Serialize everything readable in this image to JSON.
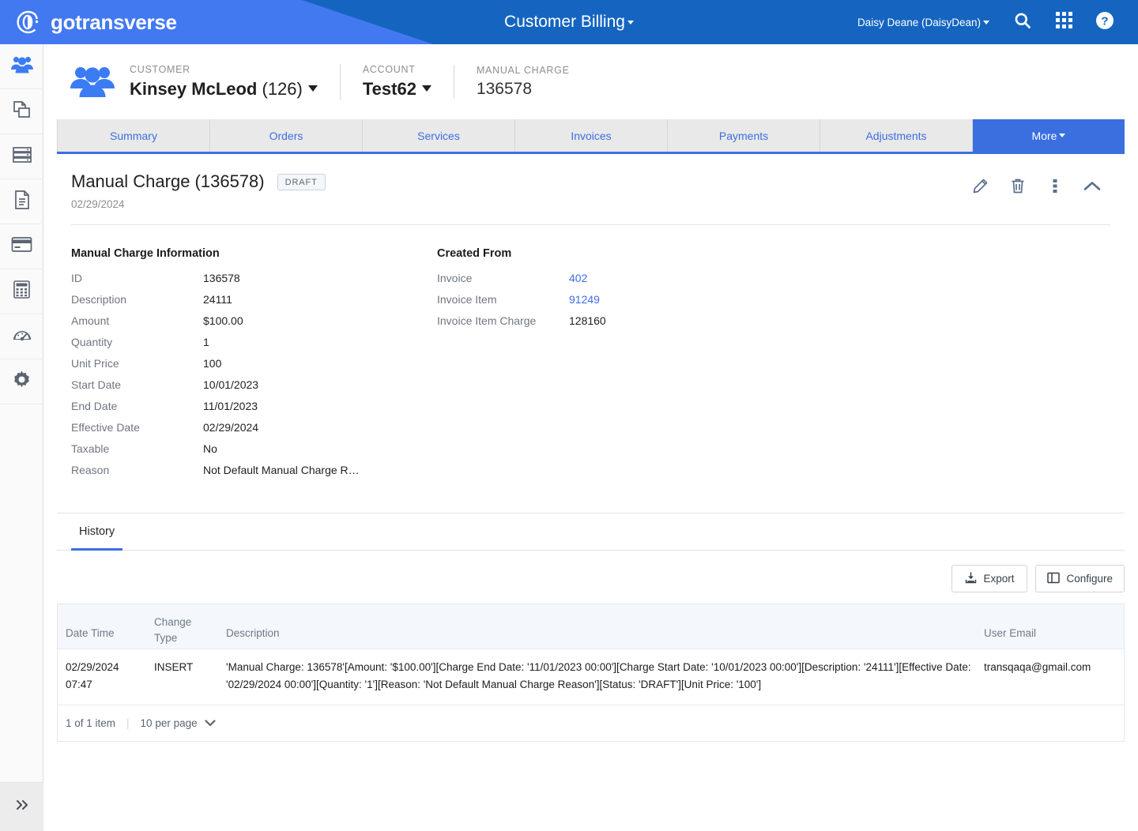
{
  "topbar": {
    "brand": "gotransverse",
    "brand_logo_icon": "gotransverse-logo-icon",
    "app_title": "Customer Billing",
    "user_menu": "Daisy Deane (DaisyDean)",
    "icons": [
      "search-icon",
      "apps-grid-icon",
      "help-circle-icon"
    ],
    "accent_light": "#4279f0",
    "accent_dark": "#1565c0"
  },
  "sidebar": {
    "items": [
      {
        "icon": "customers-icon",
        "active": true
      },
      {
        "icon": "copy-documents-icon",
        "active": false
      },
      {
        "icon": "servers-icon",
        "active": false
      },
      {
        "icon": "document-icon",
        "active": false
      },
      {
        "icon": "credit-card-icon",
        "active": false
      },
      {
        "icon": "calculator-icon",
        "active": false
      },
      {
        "icon": "gauge-icon",
        "active": false
      },
      {
        "icon": "gear-icon",
        "active": false
      }
    ],
    "expand_icon": "double-chevron-right-icon"
  },
  "context": {
    "customer": {
      "label": "CUSTOMER",
      "value": "Kinsey McLeod",
      "paren": "(126)"
    },
    "account": {
      "label": "ACCOUNT",
      "value": "Test62"
    },
    "manual_charge": {
      "label": "MANUAL CHARGE",
      "value": "136578"
    }
  },
  "tabs": [
    {
      "label": "Summary",
      "active": false
    },
    {
      "label": "Orders",
      "active": false
    },
    {
      "label": "Services",
      "active": false
    },
    {
      "label": "Invoices",
      "active": false
    },
    {
      "label": "Payments",
      "active": false
    },
    {
      "label": "Adjustments",
      "active": false
    },
    {
      "label": "More",
      "active": true
    }
  ],
  "panel": {
    "title": "Manual Charge (136578)",
    "status_badge": "DRAFT",
    "date": "02/29/2024",
    "actions": [
      {
        "icon": "pencil-edit-icon"
      },
      {
        "icon": "trash-delete-icon"
      },
      {
        "icon": "vertical-dots-more-icon"
      },
      {
        "icon": "chevron-up-collapse-icon"
      }
    ]
  },
  "details": {
    "left": {
      "heading": "Manual Charge Information",
      "rows": [
        {
          "key": "ID",
          "value": "136578",
          "link": false
        },
        {
          "key": "Description",
          "value": "24111",
          "link": false
        },
        {
          "key": "Amount",
          "value": "$100.00",
          "link": false
        },
        {
          "key": "Quantity",
          "value": "1",
          "link": false
        },
        {
          "key": "Unit Price",
          "value": "100",
          "link": false
        },
        {
          "key": "Start Date",
          "value": "10/01/2023",
          "link": false
        },
        {
          "key": "End Date",
          "value": "11/01/2023",
          "link": false
        },
        {
          "key": "Effective Date",
          "value": "02/29/2024",
          "link": false
        },
        {
          "key": "Taxable",
          "value": "No",
          "link": false
        },
        {
          "key": "Reason",
          "value": "Not Default Manual Charge R…",
          "link": false
        }
      ]
    },
    "right": {
      "heading": "Created From",
      "rows": [
        {
          "key": "Invoice",
          "value": "402",
          "link": true
        },
        {
          "key": "Invoice Item",
          "value": "91249",
          "link": true
        },
        {
          "key": "Invoice Item Charge",
          "value": "128160",
          "link": false
        }
      ]
    }
  },
  "history": {
    "tab_label": "History",
    "export_label": "Export",
    "export_icon": "download-tray-icon",
    "configure_label": "Configure",
    "configure_icon": "columns-panel-icon",
    "columns": [
      "Date Time",
      "Change Type",
      "Description",
      "User Email"
    ],
    "column_change_type_line1": "Change",
    "column_change_type_line2": "Type",
    "rows": [
      {
        "date_time_line1": "02/29/2024",
        "date_time_line2": "07:47",
        "change_type": "INSERT",
        "description": "'Manual Charge: 136578'[Amount: '$100.00'][Charge End Date: '11/01/2023 00:00'][Charge Start Date: '10/01/2023 00:00'][Description: '24111'][Effective Date: '02/29/2024 00:00'][Quantity: '1'][Reason: 'Not Default Manual Charge Reason'][Status: 'DRAFT'][Unit Price: '100']",
        "user_email": "transqaqa@gmail.com"
      }
    ],
    "footer": {
      "item_count": "1 of 1 item",
      "per_page": "10 per page",
      "per_page_icon": "chevron-down-icon"
    }
  }
}
